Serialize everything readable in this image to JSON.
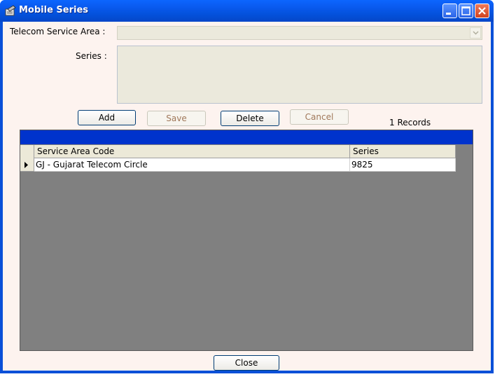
{
  "window": {
    "title": "Mobile Series"
  },
  "form": {
    "telecom_service_area_label": "Telecom Service Area :",
    "telecom_service_area_value": "",
    "series_label": "Series :",
    "series_value": ""
  },
  "toolbar": {
    "add_label": "Add",
    "save_label": "Save",
    "delete_label": "Delete",
    "cancel_label": "Cancel",
    "records_text": "1 Records"
  },
  "grid": {
    "columns": [
      "Service Area Code",
      "Series"
    ],
    "rows": [
      [
        "GJ - Gujarat Telecom Circle",
        "9825"
      ]
    ]
  },
  "footer": {
    "close_label": "Close"
  },
  "colors": {
    "title_bar": "#0a5bf0",
    "client_bg": "#fdf3ef",
    "grid_caption": "#0033cc",
    "grid_bg": "#808080",
    "disabled_button_text": "#a0785a"
  }
}
